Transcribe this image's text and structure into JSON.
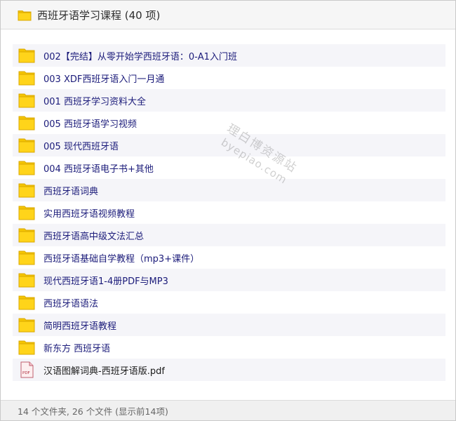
{
  "header": {
    "title": "西班牙语学习课程 (40 项)",
    "icon": "folder-icon"
  },
  "items": [
    {
      "label": "002【完结】从零开始学西班牙语：0-A1入门班",
      "type": "folder"
    },
    {
      "label": "003 XDF西班牙语入门一月通",
      "type": "folder"
    },
    {
      "label": "001 西班牙学习资料大全",
      "type": "folder"
    },
    {
      "label": "005 西班牙语学习视频",
      "type": "folder"
    },
    {
      "label": "005 现代西班牙语",
      "type": "folder"
    },
    {
      "label": "004 西班牙语电子书+其他",
      "type": "folder"
    },
    {
      "label": "西班牙语词典",
      "type": "folder"
    },
    {
      "label": "实用西班牙语视频教程",
      "type": "folder"
    },
    {
      "label": "西班牙语高中级文法汇总",
      "type": "folder"
    },
    {
      "label": "西班牙语基础自学教程（mp3+课件）",
      "type": "folder"
    },
    {
      "label": "现代西班牙语1-4册PDF与MP3",
      "type": "folder"
    },
    {
      "label": "西班牙语语法",
      "type": "folder"
    },
    {
      "label": "简明西班牙语教程",
      "type": "folder"
    },
    {
      "label": "新东方 西班牙语",
      "type": "folder"
    },
    {
      "label": "汉语图解词典-西班牙语版.pdf",
      "type": "pdf"
    }
  ],
  "watermark": {
    "line1": "理白博资源站",
    "line2": "byepiao.com"
  },
  "footer": {
    "status": "14 个文件夹, 26 个文件 (显示前14项)"
  },
  "colors": {
    "folder": "#f5c500",
    "folder_border": "#d9a800",
    "link": "#1b1b7a"
  }
}
